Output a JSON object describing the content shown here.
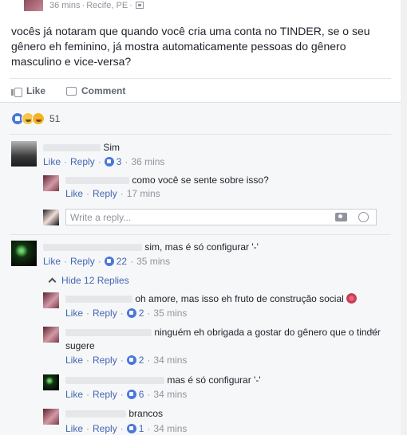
{
  "post": {
    "meta_time": "36 mins",
    "meta_location": "Recife, PE",
    "audience_icon": "public-icon",
    "text": "vocês já notaram que quando você cria uma conta no TINDER, se o seu gênero eh feminino, já mostra automaticamente pessoas do gênero masculino e vice-versa?",
    "like_label": "Like",
    "comment_label": "Comment",
    "reactions": [
      "like",
      "sad",
      "haha"
    ],
    "reaction_count": "51"
  },
  "comments": {
    "c1": {
      "text": "Sim",
      "like": "Like",
      "reply": "Reply",
      "likes": "3",
      "time": "36 mins"
    },
    "c1r1": {
      "text": "como você se sente sobre isso?",
      "like": "Like",
      "reply": "Reply",
      "time": "17 mins"
    },
    "reply_box": {
      "placeholder": "Write a reply..."
    },
    "c2": {
      "text": "sim, mas é só configurar '-'",
      "like": "Like",
      "reply": "Reply",
      "likes": "22",
      "time": "35 mins"
    },
    "hide_replies": "Hide 12 Replies",
    "r1": {
      "text": "oh amore, mas isso eh fruto de construção social",
      "like": "Like",
      "reply": "Reply",
      "likes": "2",
      "time": "35 mins"
    },
    "r2": {
      "text": "ninguém eh obrigada a gostar do gênero que o tinder",
      "text2": "sugere",
      "like": "Like",
      "reply": "Reply",
      "likes": "2",
      "time": "34 mins"
    },
    "r3": {
      "text": "mas é só configurar '-'",
      "like": "Like",
      "reply": "Reply",
      "likes": "6",
      "time": "34 mins"
    },
    "r4": {
      "text": "brancos",
      "like": "Like",
      "reply": "Reply",
      "likes": "1",
      "time": "34 mins"
    }
  },
  "colors": {
    "link": "#4267b2",
    "muted": "#90949c",
    "background": "#f6f7f9"
  }
}
